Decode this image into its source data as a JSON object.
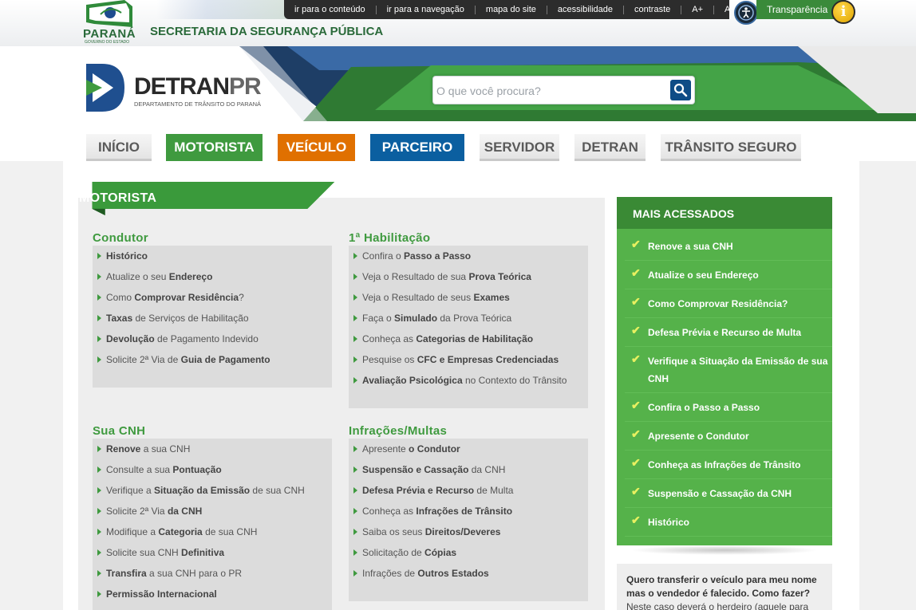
{
  "header": {
    "brand_name": "PARANÁ",
    "brand_sub": "GOVERNO DO ESTADO",
    "secretaria": "SECRETARIA DA SEGURANÇA PÚBLICA",
    "accessibility_links": [
      "ir para o conteúdo",
      "ir para a navegação",
      "mapa do site",
      "acessibilidade",
      "contraste",
      "A+",
      "A"
    ],
    "transparencia": "Transparência"
  },
  "banner": {
    "logo_main": "DETRAN",
    "logo_pr": "PR",
    "logo_sub": "DEPARTAMENTO DE TRÂNSITO DO PARANÁ",
    "search_placeholder": "O que você procura?"
  },
  "nav": {
    "tabs": [
      "INÍCIO",
      "MOTORISTA",
      "VEÍCULO",
      "PARCEIRO",
      "SERVIDOR",
      "DETRAN",
      "TRÂNSITO SEGURO"
    ]
  },
  "main": {
    "section_title": "MOTORISTA",
    "categories": [
      {
        "title": "Condutor",
        "items": [
          [
            [
              "",
              "Histórico"
            ]
          ],
          [
            [
              "Atualize o seu ",
              ""
            ],
            [
              "",
              "Endereço"
            ]
          ],
          [
            [
              "Como ",
              ""
            ],
            [
              "",
              "Comprovar Residência"
            ],
            [
              "?",
              ""
            ]
          ],
          [
            [
              "",
              "Taxas"
            ],
            [
              " de Serviços de Habilitação",
              ""
            ]
          ],
          [
            [
              "",
              "Devolução"
            ],
            [
              " de Pagamento Indevido",
              ""
            ]
          ],
          [
            [
              "Solicite 2ª Via de ",
              ""
            ],
            [
              "",
              "Guia de Pagamento"
            ]
          ]
        ]
      },
      {
        "title": "1ª Habilitação",
        "items": [
          [
            [
              "Confira o ",
              ""
            ],
            [
              "",
              "Passo a Passo"
            ]
          ],
          [
            [
              "Veja o Resultado de sua ",
              ""
            ],
            [
              "",
              "Prova Teórica"
            ]
          ],
          [
            [
              "Veja o Resultado de seus ",
              ""
            ],
            [
              "",
              "Exames"
            ]
          ],
          [
            [
              "Faça o ",
              ""
            ],
            [
              "",
              "Simulado"
            ],
            [
              " da Prova Teórica",
              ""
            ]
          ],
          [
            [
              "Conheça as ",
              ""
            ],
            [
              "",
              "Categorias de Habilitação"
            ]
          ],
          [
            [
              "Pesquise os ",
              ""
            ],
            [
              "",
              "CFC e Empresas Credenciadas"
            ]
          ],
          [
            [
              "",
              "Avaliação Psicológica"
            ],
            [
              " no Contexto do Trânsito",
              ""
            ]
          ]
        ]
      },
      {
        "title": "Sua CNH",
        "items": [
          [
            [
              "",
              "Renove"
            ],
            [
              " a sua CNH",
              ""
            ]
          ],
          [
            [
              "Consulte a sua ",
              ""
            ],
            [
              "",
              "Pontuação"
            ]
          ],
          [
            [
              "Verifique a ",
              ""
            ],
            [
              "",
              "Situação da Emissão"
            ],
            [
              " de sua CNH",
              ""
            ]
          ],
          [
            [
              "Solicite 2ª Via ",
              ""
            ],
            [
              "",
              "da CNH"
            ]
          ],
          [
            [
              "Modifique a ",
              ""
            ],
            [
              "",
              "Categoria"
            ],
            [
              " de sua CNH",
              ""
            ]
          ],
          [
            [
              "Solicite sua CNH ",
              ""
            ],
            [
              "",
              "Definitiva"
            ]
          ],
          [
            [
              "",
              "Transfira"
            ],
            [
              " a sua CNH para o PR",
              ""
            ]
          ],
          [
            [
              "",
              "Permissão Internacional"
            ]
          ]
        ]
      },
      {
        "title": "Infrações/Multas",
        "items": [
          [
            [
              "Apresente ",
              ""
            ],
            [
              "",
              "o Condutor"
            ]
          ],
          [
            [
              "",
              "Suspensão e Cassação"
            ],
            [
              " da CNH",
              ""
            ]
          ],
          [
            [
              "",
              "Defesa Prévia e Recurso"
            ],
            [
              " de Multa",
              ""
            ]
          ],
          [
            [
              "Conheça as ",
              ""
            ],
            [
              "",
              "Infrações de Trânsito"
            ]
          ],
          [
            [
              "Saiba os seus ",
              ""
            ],
            [
              "",
              "Direitos/Deveres"
            ]
          ],
          [
            [
              "Solicitação de ",
              ""
            ],
            [
              "",
              "Cópias"
            ]
          ],
          [
            [
              "Infrações de ",
              ""
            ],
            [
              "",
              "Outros Estados"
            ]
          ]
        ]
      }
    ]
  },
  "sidebar": {
    "title": "MAIS ACESSADOS",
    "items": [
      "Renove a sua CNH",
      "Atualize o seu Endereço",
      "Como Comprovar Residência?",
      "Defesa Prévia e Recurso de Multa",
      "Verifique a Situação da Emissão de sua CNH",
      "Confira o Passo a Passo",
      "Apresente o Condutor",
      "Conheça as Infrações de Trânsito",
      "Suspensão e Cassação da CNH",
      "Histórico"
    ],
    "faq_question": "Quero transferir o veículo para meu nome mas o vendedor é falecido. Como fazer?",
    "faq_answer": "Neste caso deverá o herdeiro (aquele para"
  },
  "colors": {
    "green": "#3f9a3f",
    "orange": "#e07000",
    "blue": "#0b5fa0",
    "dark_blue": "#0e4c86",
    "light_green": "#55b24a"
  },
  "icons": {
    "search": "magnifier-icon",
    "accessibility": "accessibility-person-icon",
    "info": "info-icon",
    "arrow": "triangle-bullet-icon",
    "check": "check-icon"
  }
}
